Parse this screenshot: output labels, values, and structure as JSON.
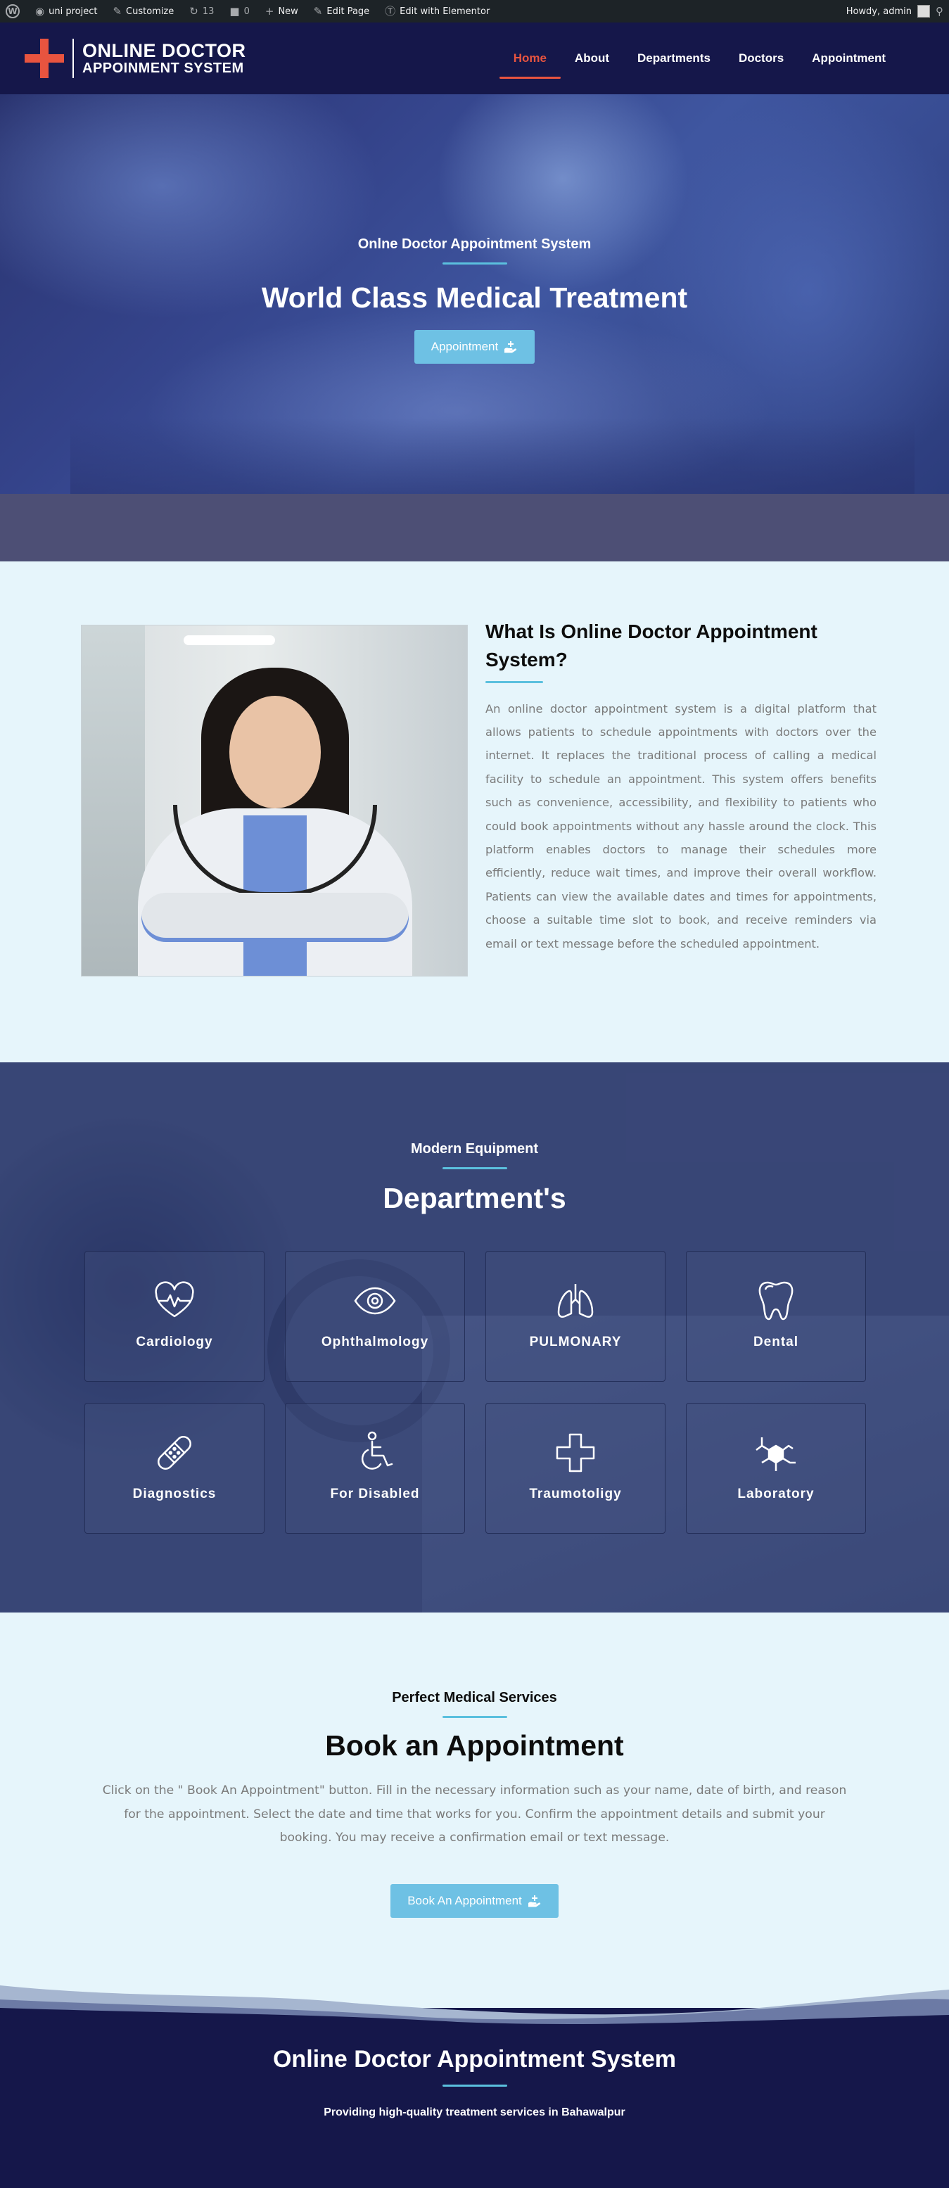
{
  "adminbar": {
    "site_name": "uni project",
    "customize": "Customize",
    "updates_count": "13",
    "comments_count": "0",
    "new": "New",
    "edit_page": "Edit Page",
    "elementor": "Edit with Elementor",
    "greeting": "Howdy, admin"
  },
  "header": {
    "logo_line1": "ONLINE DOCTOR",
    "logo_line2": "APPOINMENT SYSTEM",
    "nav": [
      "Home",
      "About",
      "Departments",
      "Doctors",
      "Appointment"
    ],
    "active_nav": "Home"
  },
  "hero": {
    "subtitle": "Onlne Doctor Appointment System",
    "title": "World Class Medical Treatment",
    "button": "Appointment"
  },
  "about": {
    "title": "What Is Online Doctor Appointment System?",
    "paragraph": "An online doctor appointment system is a digital platform that allows patients to schedule appointments with doctors over the internet. It replaces the traditional process of calling a medical facility to schedule an appointment. This system offers benefits such as convenience, accessibility, and flexibility to patients who could book appointments without any hassle around the clock. This platform enables doctors to manage their schedules more efficiently, reduce wait times, and improve their overall workflow. Patients can view the available dates and times for appointments, choose a suitable time slot to book, and receive reminders via email or text message before the scheduled appointment."
  },
  "departments": {
    "subtitle": "Modern Equipment",
    "title": "Department's",
    "items": [
      {
        "label": "Cardiology",
        "icon": "heart-pulse-icon"
      },
      {
        "label": "Ophthalmology",
        "icon": "eye-icon"
      },
      {
        "label": "PULMONARY",
        "icon": "lungs-icon"
      },
      {
        "label": "Dental",
        "icon": "tooth-icon"
      },
      {
        "label": "Diagnostics",
        "icon": "bandage-icon"
      },
      {
        "label": "For Disabled",
        "icon": "wheelchair-icon"
      },
      {
        "label": "Traumotoligy",
        "icon": "medical-cross-icon"
      },
      {
        "label": "Laboratory",
        "icon": "molecule-icon"
      }
    ]
  },
  "booking": {
    "subtitle": "Perfect Medical Services",
    "title": "Book an Appointment",
    "paragraph": "Click on the \" Book An Appointment\" button. Fill in the necessary information such as your name, date of birth, and reason for the appointment. Select the date and time that works for you. Confirm the appointment details and submit your booking. You may receive a confirmation email or text message.",
    "button": "Book An Appointment"
  },
  "footer": {
    "title": "Online Doctor Appointment System",
    "subtitle": "Providing high-quality treatment services in Bahawalpur"
  },
  "colors": {
    "accent": "#6ec1e4",
    "divider": "#5bc0de",
    "active_nav": "#e8543f",
    "navy": "#15174a",
    "page_bg": "#e6f5fb"
  }
}
